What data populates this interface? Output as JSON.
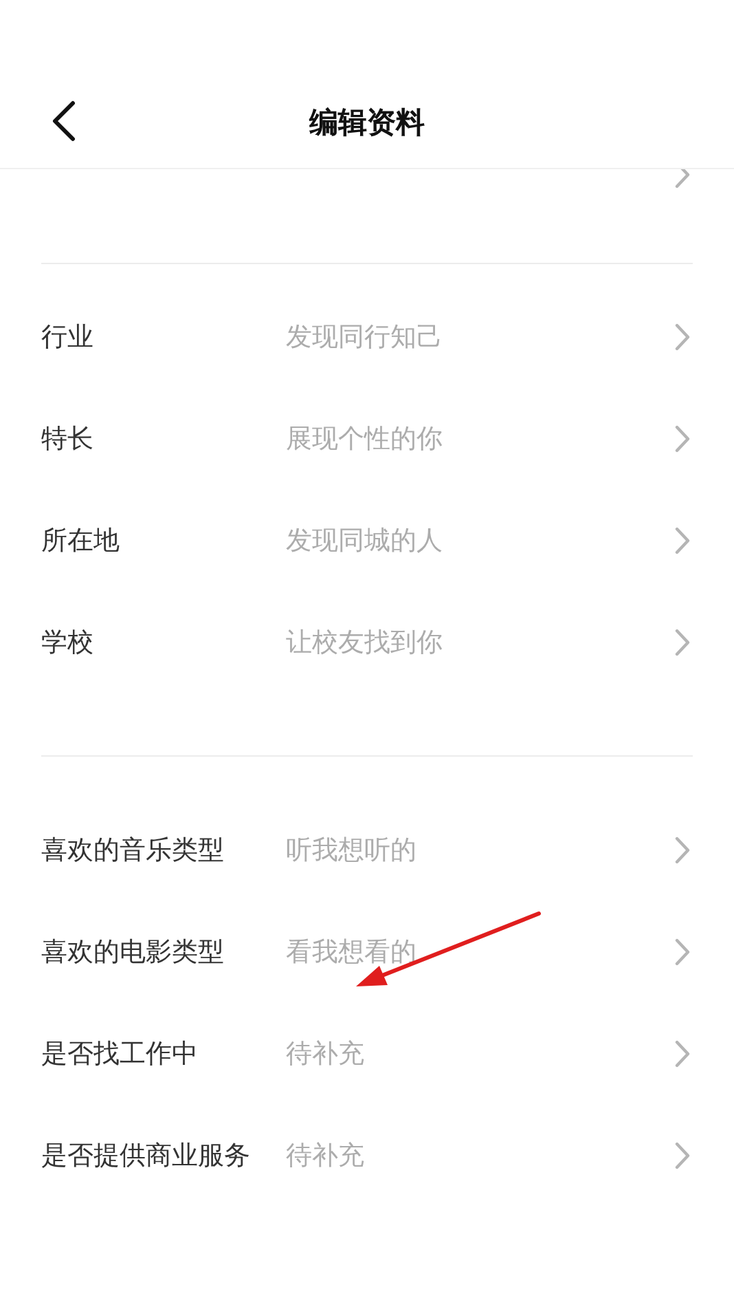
{
  "header": {
    "title": "编辑资料"
  },
  "sections": [
    {
      "rows": [
        {
          "kind": "cut"
        }
      ]
    },
    {
      "rows": [
        {
          "label": "行业",
          "hint": "发现同行知己"
        },
        {
          "label": "特长",
          "hint": "展现个性的你"
        },
        {
          "label": "所在地",
          "hint": "发现同城的人"
        },
        {
          "label": "学校",
          "hint": "让校友找到你"
        }
      ]
    },
    {
      "rows": [
        {
          "label": "喜欢的音乐类型",
          "hint": "听我想听的"
        },
        {
          "label": "喜欢的电影类型",
          "hint": "看我想看的"
        },
        {
          "label": "是否找工作中",
          "hint": "待补充"
        },
        {
          "label": "是否提供商业服务",
          "hint": "待补充"
        }
      ]
    }
  ]
}
